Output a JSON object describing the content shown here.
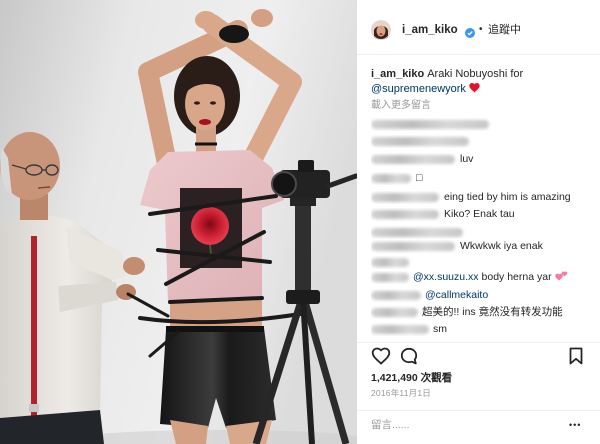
{
  "header": {
    "username": "i_am_kiko",
    "separator": "•",
    "follow_status": "追蹤中",
    "verified_icon": "verified-badge-icon"
  },
  "caption": {
    "username": "i_am_kiko",
    "text": "Araki Nobuyoshi for",
    "mention": "@supremenewyork",
    "emoji_icon": "red-heart-icon"
  },
  "load_more_label": "載入更多留言",
  "comments": [
    {
      "text": "luv"
    },
    {
      "text": "□"
    },
    {
      "text": "eing tied by him is amazing"
    },
    {
      "text": "Kiko? Enak tau"
    },
    {
      "text": "Wkwkwk iya enak"
    },
    {
      "mention": "@xx.suuzu.xx",
      "text": "body herna yar",
      "emoji_icon": "two-hearts-icon"
    },
    {
      "mention": "@callmekaito"
    },
    {
      "text": "超美的!! ins 竟然没有转发功能"
    },
    {
      "text": "sm"
    }
  ],
  "actions": {
    "like_icon": "heart-outline-icon",
    "comment_icon": "comment-icon",
    "save_icon": "bookmark-icon"
  },
  "views": "1,421,490 次觀看",
  "date": "2016年11月1日",
  "comment_box": {
    "placeholder": "留言......",
    "more_label": "•••"
  },
  "colors": {
    "link": "#003569",
    "verified": "#3897f0",
    "muted": "#999999",
    "divider": "#efefef",
    "heart": "#e8112d",
    "pink_heart": "#f47ba4"
  }
}
